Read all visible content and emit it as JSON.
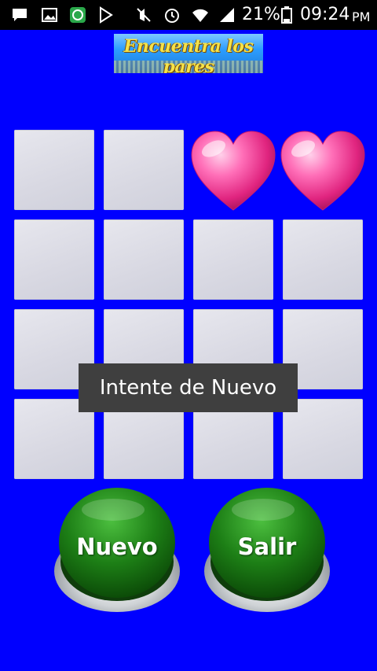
{
  "status_bar": {
    "battery_percent": "21%",
    "time": "09:24",
    "ampm": "PM",
    "icons": [
      "chat-icon",
      "image-icon",
      "android-app-icon",
      "play-store-icon",
      "mute-icon",
      "alarm-icon",
      "wifi-icon",
      "signal-icon",
      "battery-icon"
    ]
  },
  "logo": {
    "text": "Encuentra los pares"
  },
  "board": {
    "rows": 4,
    "cols": 4,
    "cells": [
      "hidden",
      "hidden",
      "heart",
      "heart",
      "hidden",
      "hidden",
      "hidden",
      "hidden",
      "hidden",
      "hidden",
      "hidden",
      "hidden",
      "hidden",
      "hidden",
      "hidden",
      "hidden"
    ]
  },
  "toast": {
    "message": "Intente de Nuevo"
  },
  "buttons": {
    "new_label": "Nuevo",
    "exit_label": "Salir"
  },
  "colors": {
    "background": "#0000ff",
    "card": "#dcdce4",
    "button_green": "#1f8a1f",
    "heart": "#f0449a"
  }
}
